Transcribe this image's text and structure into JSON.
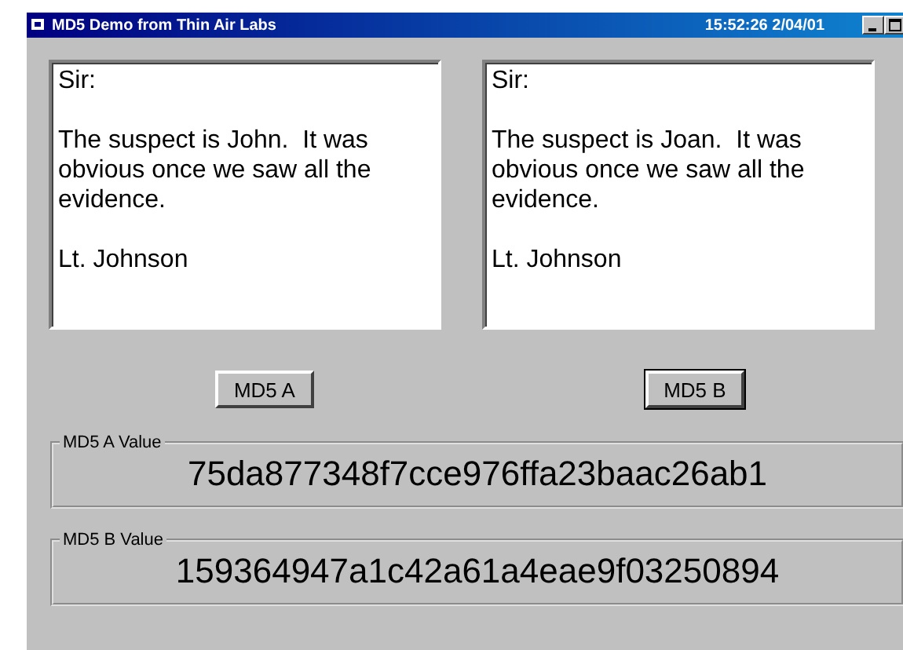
{
  "window": {
    "title": "MD5 Demo from Thin Air Labs",
    "clock": "15:52:26  2/04/01"
  },
  "documents": [
    {
      "paragraphs": [
        "Sir:",
        "The suspect is John.  It was obvious once we saw all the evidence.",
        "Lt. Johnson"
      ]
    },
    {
      "paragraphs": [
        "Sir:",
        "The suspect is Joan.  It was obvious once we saw all the evidence.",
        "Lt. Johnson"
      ]
    }
  ],
  "buttons": [
    {
      "label": "MD5 A",
      "focused": false
    },
    {
      "label": "MD5 B",
      "focused": true
    }
  ],
  "results": [
    {
      "label": "MD5 A Value",
      "value": "75da877348f7cce976ffa23baac26ab1"
    },
    {
      "label": "MD5 B Value",
      "value": "159364947a1c42a61a4eae9f03250894"
    }
  ]
}
